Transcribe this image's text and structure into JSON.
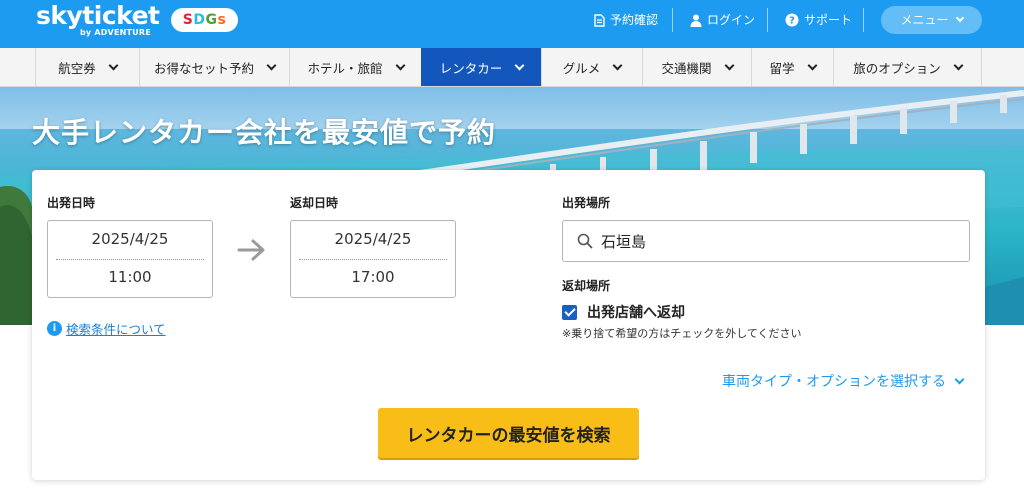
{
  "header": {
    "logo": "skyticket",
    "logo_sub": "by ADVENTURE",
    "sdgs": [
      "S",
      "D",
      "G",
      "s"
    ],
    "links": [
      {
        "label": "予約確認",
        "icon": "document-icon"
      },
      {
        "label": "ログイン",
        "icon": "user-icon"
      },
      {
        "label": "サポート",
        "icon": "help-circle-icon"
      }
    ],
    "menu_label": "メニュー"
  },
  "nav": {
    "items": [
      {
        "label": "航空券"
      },
      {
        "label": "お得なセット予約"
      },
      {
        "label": "ホテル・旅館"
      },
      {
        "label": "レンタカー",
        "active": true
      },
      {
        "label": "グルメ"
      },
      {
        "label": "交通機関"
      },
      {
        "label": "留学"
      },
      {
        "label": "旅のオプション"
      }
    ]
  },
  "hero": {
    "title": "大手レンタカー会社を最安値で予約"
  },
  "search": {
    "departure_label": "出発日時",
    "departure_date": "2025/4/25",
    "departure_time": "11:00",
    "return_label": "返却日時",
    "return_date": "2025/4/25",
    "return_time": "17:00",
    "info_link": "検索条件について",
    "pickup_label": "出発場所",
    "pickup_value": "石垣島",
    "dropoff_label": "返却場所",
    "same_store_label": "出発店舗へ返却",
    "same_store_checked": true,
    "note": "※乗り捨て希望の方はチェックを外してください",
    "options_link": "車両タイプ・オプションを選択する",
    "submit_label": "レンタカーの最安値を検索"
  },
  "colors": {
    "brand_blue": "#1d9bf0",
    "nav_active": "#1357bd",
    "search_button": "#f8bd16"
  }
}
